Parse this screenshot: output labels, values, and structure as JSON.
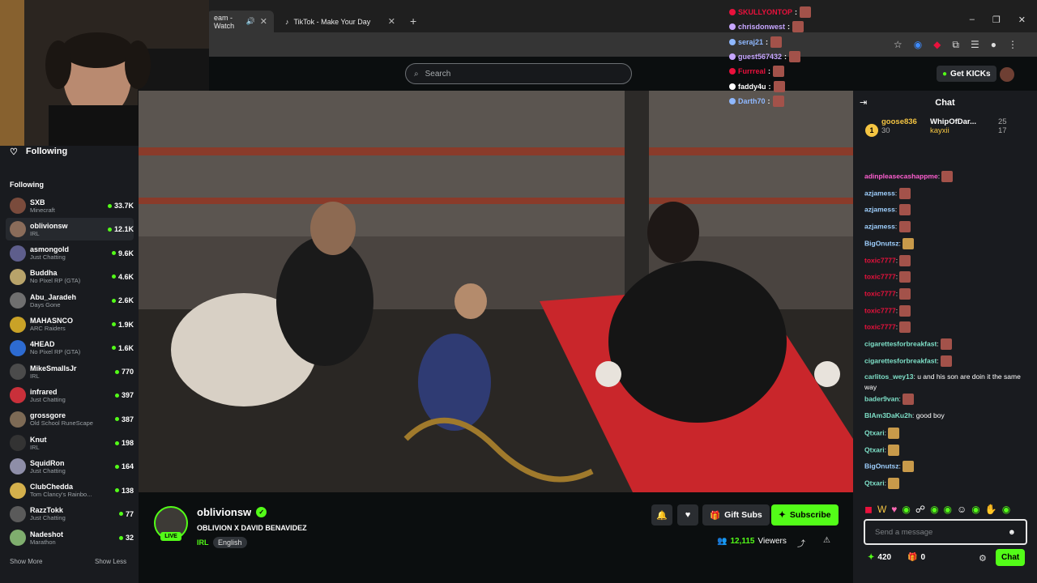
{
  "browser": {
    "tabs": [
      {
        "label": "eam - Watch"
      },
      {
        "label": "TikTok - Make Your Day"
      }
    ],
    "new_tab": "+",
    "window_controls": [
      "–",
      "❐",
      "✕"
    ]
  },
  "header": {
    "search_placeholder": "Search",
    "get_kicks": "Get KICKs"
  },
  "sidebar": {
    "following_toggle": "Following",
    "following_label": "Following",
    "channels": [
      {
        "name": "SXB",
        "category": "Minecraft",
        "viewers": "33.7K",
        "color": "#7a4b3c"
      },
      {
        "name": "oblivionsw",
        "category": "IRL",
        "viewers": "12.1K",
        "color": "#8a6c5a",
        "selected": true
      },
      {
        "name": "asmongold",
        "category": "Just Chatting",
        "viewers": "9.6K",
        "color": "#5e5e8c"
      },
      {
        "name": "Buddha",
        "category": "No Pixel RP (GTA)",
        "viewers": "4.6K",
        "color": "#b8a36a"
      },
      {
        "name": "Abu_Jaradeh",
        "category": "Days Gone",
        "viewers": "2.6K",
        "color": "#6f6f6f"
      },
      {
        "name": "MAHASNCO",
        "category": "ARC Raiders",
        "viewers": "1.9K",
        "color": "#c9a227"
      },
      {
        "name": "4HEAD",
        "category": "No Pixel RP (GTA)",
        "viewers": "1.6K",
        "color": "#2d6bd1"
      },
      {
        "name": "MikeSmallsJr",
        "category": "IRL",
        "viewers": "770",
        "color": "#4b4b4b"
      },
      {
        "name": "infrared",
        "category": "Just Chatting",
        "viewers": "397",
        "color": "#c9303a"
      },
      {
        "name": "grossgore",
        "category": "Old School RuneScape",
        "viewers": "387",
        "color": "#7d6a55"
      },
      {
        "name": "Knut",
        "category": "IRL",
        "viewers": "198",
        "color": "#333333"
      },
      {
        "name": "SquidRon",
        "category": "Just Chatting",
        "viewers": "164",
        "color": "#8e8ea8"
      },
      {
        "name": "ClubChedda",
        "category": "Tom Clancy's Rainbo...",
        "viewers": "138",
        "color": "#d4b04c"
      },
      {
        "name": "RazzTokk",
        "category": "Just Chatting",
        "viewers": "77",
        "color": "#5a5a5a"
      },
      {
        "name": "Nadeshot",
        "category": "Marathon",
        "viewers": "32",
        "color": "#7fae6e"
      }
    ],
    "show_more": "Show More",
    "show_less": "Show Less"
  },
  "stream": {
    "channel": "oblivionsw",
    "live_badge": "LIVE",
    "title": "OBLIVION X DAVID BENAVIDEZ",
    "category": "IRL",
    "language": "English",
    "gift_subs": "Gift Subs",
    "subscribe": "Subscribe",
    "viewers": "12,115",
    "viewers_label": "Viewers"
  },
  "overlay_chat": [
    {
      "user": "SKULLYONTOP",
      "color": "#e9113c"
    },
    {
      "user": "chrisdonwest",
      "color": "#c7a6ff"
    },
    {
      "user": "seraj21",
      "color": "#8fb8ff"
    },
    {
      "user": "guest567432",
      "color": "#c7a6ff"
    },
    {
      "user": "Furrreal",
      "color": "#e9113c"
    },
    {
      "user": "faddy4u",
      "color": "#ffffff"
    },
    {
      "user": "Darth70",
      "color": "#8fb8ff"
    }
  ],
  "chat": {
    "title": "Chat",
    "pinned": [
      {
        "rank": "1",
        "user": "goose836",
        "amount": "30"
      },
      {
        "user": "WhipOfDar...",
        "amount": "25"
      },
      {
        "user": "kayxii",
        "amount": "17"
      }
    ],
    "messages": [
      {
        "user": "adinpleasecashappme",
        "text": "",
        "color": "#ff5fd1",
        "emote": "#a3524a"
      },
      {
        "user": "azjamess",
        "text": "",
        "color": "#9fd0ff",
        "emote": "#a3524a"
      },
      {
        "user": "azjamess",
        "text": "",
        "color": "#9fd0ff",
        "emote": "#a3524a"
      },
      {
        "user": "azjamess",
        "text": "",
        "color": "#9fd0ff",
        "emote": "#a3524a"
      },
      {
        "user": "BigOnutsz",
        "text": "",
        "color": "#9fd0ff",
        "emote": "#c89a4a"
      },
      {
        "user": "toxic7777",
        "text": "",
        "color": "#e9113c",
        "emote": "#a3524a"
      },
      {
        "user": "toxic7777",
        "text": "",
        "color": "#e9113c",
        "emote": "#a3524a"
      },
      {
        "user": "toxic7777",
        "text": "",
        "color": "#e9113c",
        "emote": "#a3524a"
      },
      {
        "user": "toxic7777",
        "text": "",
        "color": "#e9113c",
        "emote": "#a3524a"
      },
      {
        "user": "toxic7777",
        "text": "",
        "color": "#e9113c",
        "emote": "#a3524a"
      },
      {
        "user": "cigarettesforbreakfast",
        "text": "",
        "color": "#7ee0c8",
        "emote": "#a3524a"
      },
      {
        "user": "cigarettesforbreakfast",
        "text": "",
        "color": "#7ee0c8",
        "emote": "#a3524a"
      },
      {
        "user": "carlitos_wey13",
        "text": "u and his son are doin it the same way",
        "color": "#7ee0c8",
        "emote": ""
      },
      {
        "user": "bader9van",
        "text": "",
        "color": "#7ee0c8",
        "emote": "#a3524a"
      },
      {
        "user": "BIAm3DaKu2h",
        "text": "good boy",
        "color": "#7ee0c8",
        "emote": ""
      },
      {
        "user": "Qtxari",
        "text": "",
        "color": "#7ee0c8",
        "emote": "#c89a4a"
      },
      {
        "user": "Qtxari",
        "text": "",
        "color": "#7ee0c8",
        "emote": "#c89a4a"
      },
      {
        "user": "BigOnutsz",
        "text": "",
        "color": "#9fd0ff",
        "emote": "#c89a4a"
      },
      {
        "user": "Qtxari",
        "text": "",
        "color": "#7ee0c8",
        "emote": "#c89a4a"
      }
    ],
    "input_placeholder": "Send a message",
    "kicks_balance": "420",
    "gift_balance": "0",
    "send_button": "Chat"
  },
  "colors": {
    "accent": "#53fc18",
    "live": "#e9113c",
    "background": "#0b0e0f",
    "panel": "#191b1f"
  }
}
